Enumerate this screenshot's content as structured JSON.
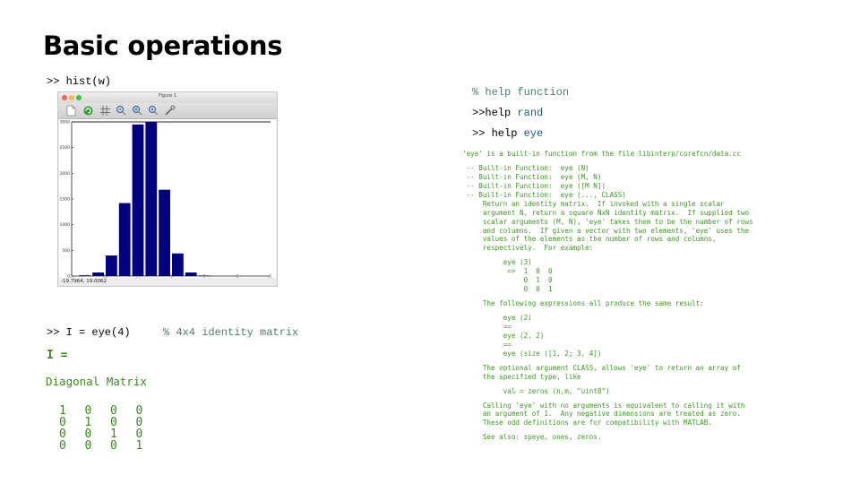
{
  "slide": {
    "title": "Basic operations"
  },
  "left": {
    "hist_cmd": ">> hist(w)",
    "eye_cmd": ">> I = eye(4)",
    "eye_comment": "% 4x4 identity matrix",
    "result_var": "I =",
    "result_type": "Diagonal Matrix",
    "matrix": [
      [
        "1",
        "0",
        "0",
        "0"
      ],
      [
        "0",
        "1",
        "0",
        "0"
      ],
      [
        "0",
        "0",
        "1",
        "0"
      ],
      [
        "0",
        "0",
        "0",
        "1"
      ]
    ]
  },
  "figure_window": {
    "title": "Figure 1",
    "toolbar": [
      "new-figure",
      "refresh",
      "grid",
      "zoom-out",
      "zoom-in",
      "zoom-reset",
      "wrench"
    ],
    "status": "-19.7964, 19.0062",
    "colors": {
      "bar": "#000080"
    }
  },
  "chart_data": {
    "type": "bar",
    "title": "",
    "xlabel": "",
    "ylabel": "",
    "x": [
      -18,
      -16,
      -14,
      -12,
      -10,
      -8,
      -6,
      -4,
      -2,
      0
    ],
    "x_note": "bin centers approximate (hist of w, 10 bins)",
    "values": [
      15,
      70,
      400,
      1420,
      2950,
      3000,
      1680,
      440,
      70,
      10
    ],
    "xlim": [
      -20,
      10
    ],
    "ylim": [
      0,
      3000
    ],
    "xticks": [
      "-20",
      "-15",
      "-10",
      "-5",
      "0",
      "5",
      "10"
    ],
    "yticks": [
      "0",
      "500",
      "1000",
      "1500",
      "2000",
      "2500",
      "3000"
    ],
    "grid": false,
    "legend": "none"
  },
  "right": {
    "help_comment": "% help function",
    "help_rand_prefix": ">>help ",
    "help_rand_arg": "rand",
    "help_eye_prefix": ">> help ",
    "help_eye_arg": "eye",
    "help_text": [
      "'eye' is a built-in function from the file libinterp/corefcn/data.cc",
      "",
      " -- Built-in Function:  eye (N)",
      " -- Built-in Function:  eye (M, N)",
      " -- Built-in Function:  eye ([M N])",
      " -- Built-in Function:  eye (..., CLASS)",
      "     Return an identity matrix.  If invoked with a single scalar",
      "     argument N, return a square NxN identity matrix.  If supplied two",
      "     scalar arguments (M, N), 'eye' takes them to be the number of rows",
      "     and columns.  If given a vector with two elements, 'eye' uses the",
      "     values of the elements as the number of rows and columns,",
      "     respectively.  For example:",
      "",
      "          eye (3)",
      "           =>  1  0  0",
      "               0  1  0",
      "               0  0  1",
      "",
      "     The following expressions all produce the same result:",
      "",
      "          eye (2)",
      "          ==",
      "          eye (2, 2)",
      "          ==",
      "          eye (size ([1, 2; 3, 4])",
      "",
      "     The optional argument CLASS, allows 'eye' to return an array of",
      "     the specified type, like",
      "",
      "          val = zeros (n,m, \"uint8\")",
      "",
      "     Calling 'eye' with no arguments is equivalent to calling it with",
      "     an argument of 1.  Any negative dimensions are treated as zero.",
      "     These odd definitions are for compatibility with MATLAB.",
      "",
      "     See also: speye, ones, zeros."
    ]
  }
}
